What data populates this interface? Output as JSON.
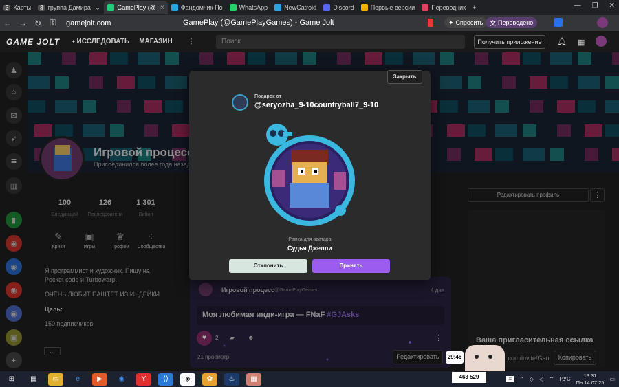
{
  "browser": {
    "tabs": [
      {
        "label": "Карты",
        "badge": "3",
        "color": "#4a6cf0"
      },
      {
        "label": "группа Дамира",
        "badge": "3",
        "color": "#4a6cf0"
      },
      {
        "label": "GamePlay (@",
        "color": "#1fd07a",
        "active": true
      },
      {
        "label": "Фандомчик По",
        "color": "#2aa3e0"
      },
      {
        "label": "WhatsApp",
        "color": "#25d366"
      },
      {
        "label": "NewCatroid",
        "color": "#2aa3e0"
      },
      {
        "label": "Discord",
        "color": "#5865f2"
      },
      {
        "label": "Первые версии",
        "color": "#f0b400"
      },
      {
        "label": "Переводчик",
        "color": "#e34060"
      }
    ],
    "url": "gamejolt.com",
    "page_title": "GamePlay (@GamePlayGames) - Game Jolt",
    "ask_label": "Спросить",
    "translated_label": "Переведено"
  },
  "site": {
    "logo": "GAME JOLT",
    "nav_explore": "ИССЛЕДОВАТЬ",
    "nav_store": "МАГАЗИН",
    "search_placeholder": "Поиск",
    "get_app": "Получить приложение"
  },
  "profile": {
    "name": "Игровой процесс",
    "joined": "Присоединился более года назад",
    "stats": [
      {
        "value": "100",
        "label": "Следующий"
      },
      {
        "value": "126",
        "label": "Последователи"
      },
      {
        "value": "1 301",
        "label": "Вибил"
      }
    ],
    "quick_links": [
      {
        "label": "Крики",
        "icon": "✎"
      },
      {
        "label": "Игры",
        "icon": "▣"
      },
      {
        "label": "Трофеи",
        "icon": "♛"
      },
      {
        "label": "Сообщества",
        "icon": "⁘"
      }
    ],
    "bio_line1": "Я программист и художник. Пишу на",
    "bio_line2": "Pocket code и Turbowarp.",
    "bio_line3": "ОЧЕНЬ ЛЮБИТ ПАШТЕТ ИЗ ИНДЕЙКИ",
    "goal_title": "Цель:",
    "goal_text": "150 подписчиков",
    "edit_profile": "Редактировать профиль",
    "invite_title": "Ваша пригласительная ссылка",
    "invite_url": ".com/invite/Gan",
    "copy": "Копировать"
  },
  "post": {
    "author": "Игровой процесс",
    "handle": "@GamePlayGemes",
    "age": "4 дня",
    "text": "Моя любимая инди-игра — FNaF",
    "tag": "#GJAsks",
    "likes": "2",
    "views": "21 просмотр",
    "edit": "Редактировать"
  },
  "modal": {
    "close": "Закрыть",
    "gift_from": "Подарок от",
    "gift_user": "@seryozha_9-10countryball7_9-10",
    "frame_label": "Рамка для аватара",
    "frame_name": "Судья Джелли",
    "decline": "Отклонить",
    "accept": "Принять"
  },
  "widgets": {
    "timer": "29:46",
    "counter": "463 529"
  },
  "taskbar": {
    "lang": "РУС",
    "time": "13:31",
    "date": "Пн 14.07.25"
  }
}
